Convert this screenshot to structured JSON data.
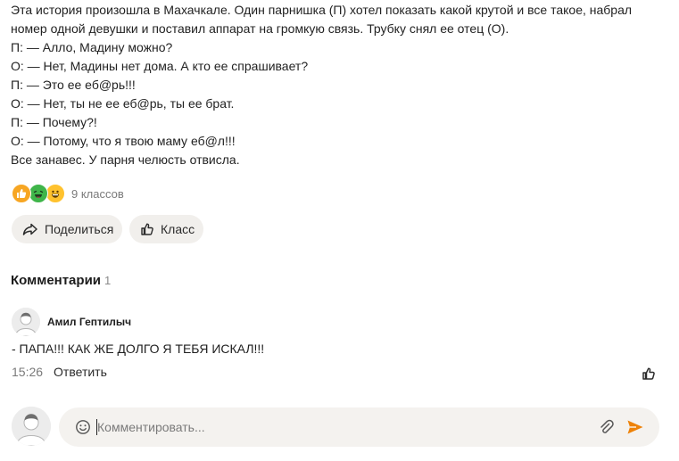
{
  "post": {
    "lines": [
      "Эта история произошла в Махачкале. Один парнишка (П) хотел показать какой крутой и все такое, набрал",
      "номер одной девушки и поставил аппарат на громкую связь. Трубку снял ее отец (О).",
      "П: — Алло, Мадину можно?",
      "О: — Нет, Мадины нет дома. А кто ее спрашивает?",
      "П: — Это ее еб@рь!!!",
      "О: — Нет, ты не ее еб@рь, ты ее брат.",
      "П: — Почему?!",
      "О: — Потому, что я твою маму еб@л!!!",
      "Все занавес. У парня челюсть отвисла."
    ]
  },
  "reactions": {
    "emojis": [
      "thumbs-up-emoji",
      "laughing-emoji",
      "grinning-emoji"
    ],
    "count_text": "9 классов"
  },
  "actions": {
    "share_label": "Поделиться",
    "klass_label": "Класс"
  },
  "comments": {
    "title": "Комментарии",
    "count": "1",
    "items": [
      {
        "author": "Амил Гептилыч",
        "text": "- ПАПА!!! КАК ЖЕ ДОЛГО Я ТЕБЯ ИСКАЛ!!!",
        "time": "15:26",
        "reply_label": "Ответить"
      }
    ]
  },
  "composer": {
    "value": "",
    "placeholder": "Комментировать..."
  },
  "colors": {
    "accent": "#ee8208",
    "button_bg": "#f1efec",
    "input_bg": "#f4f2ef"
  }
}
